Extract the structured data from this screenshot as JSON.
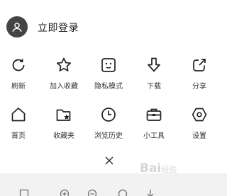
{
  "account": {
    "login_label": "立即登录"
  },
  "menu": {
    "row1": [
      {
        "label": "刷新",
        "icon": "refresh-icon"
      },
      {
        "label": "加入收藏",
        "icon": "star-icon"
      },
      {
        "label": "隐私模式",
        "icon": "privacy-mode-icon"
      },
      {
        "label": "下载",
        "icon": "download-icon"
      },
      {
        "label": "分享",
        "icon": "share-icon"
      }
    ],
    "row2": [
      {
        "label": "首页",
        "icon": "home-icon"
      },
      {
        "label": "收藏夹",
        "icon": "bookmarks-folder-icon"
      },
      {
        "label": "浏览历史",
        "icon": "history-clock-icon"
      },
      {
        "label": "小工具",
        "icon": "toolbox-icon"
      },
      {
        "label": "设置",
        "icon": "settings-hexagon-icon"
      }
    ]
  },
  "bottom_bar": {
    "icons": [
      "tabs-icon",
      "zoom-in-icon",
      "zoom-out-icon",
      "search-icon",
      "download-arrow-icon"
    ]
  },
  "watermark": {
    "brand": "Bai",
    "suffix": "经验"
  },
  "colors": {
    "icon": "#222222",
    "avatar_bg": "#444444",
    "bottom_bar_bg": "#f2f2f2"
  }
}
